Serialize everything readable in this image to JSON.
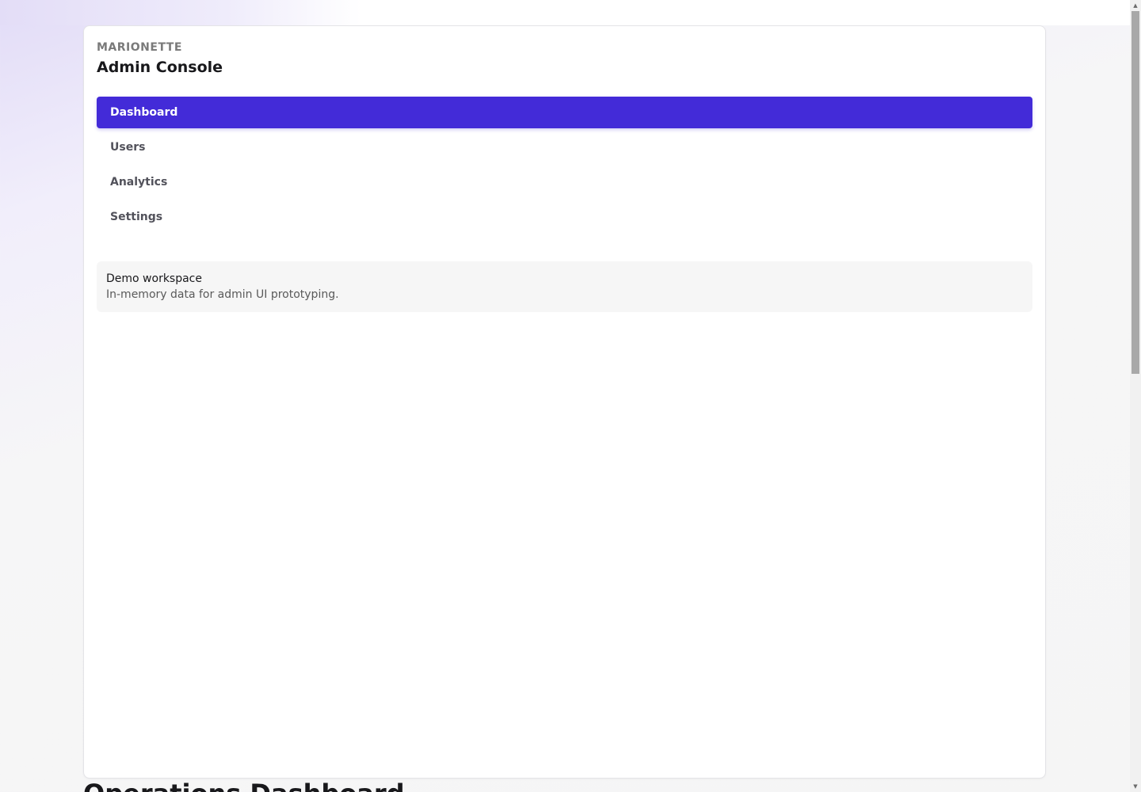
{
  "brand": {
    "eyebrow": "MARIONETTE",
    "title": "Admin Console"
  },
  "nav": {
    "items": [
      {
        "label": "Dashboard",
        "active": true
      },
      {
        "label": "Users",
        "active": false
      },
      {
        "label": "Analytics",
        "active": false
      },
      {
        "label": "Settings",
        "active": false
      }
    ]
  },
  "workspace": {
    "name": "Demo workspace",
    "description": "In-memory data for admin UI prototyping."
  },
  "main": {
    "heading": "Operations Dashboard"
  },
  "colors": {
    "accent": "#432bd8",
    "panel_background": "#ffffff",
    "card_background": "#f6f6f6"
  },
  "scrollbar": {
    "up_icon": "scroll-up-arrow-icon",
    "down_icon": "scroll-down-arrow-icon"
  }
}
